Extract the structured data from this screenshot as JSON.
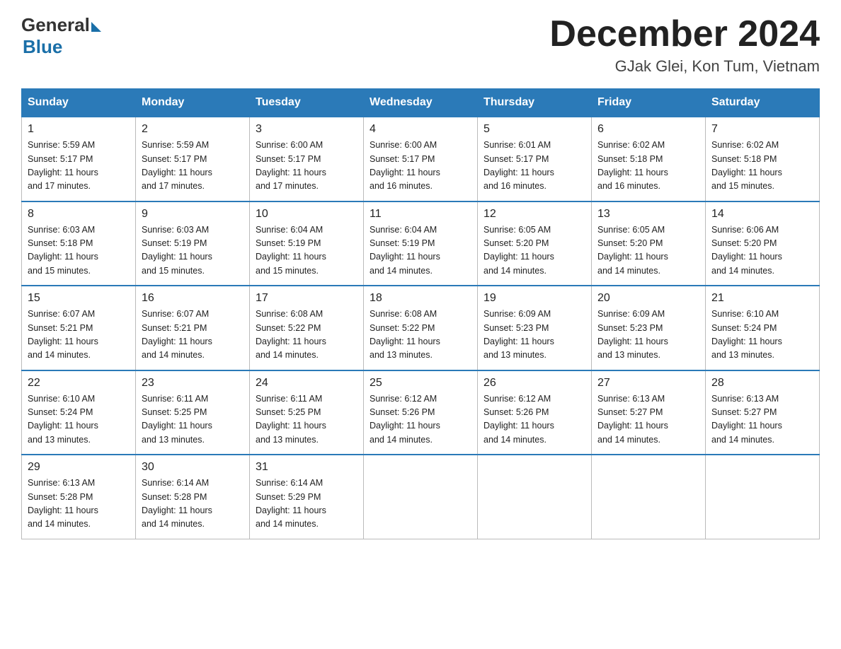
{
  "header": {
    "logo_general": "General",
    "logo_blue": "Blue",
    "month_title": "December 2024",
    "location": "GJak Glei, Kon Tum, Vietnam"
  },
  "weekdays": [
    "Sunday",
    "Monday",
    "Tuesday",
    "Wednesday",
    "Thursday",
    "Friday",
    "Saturday"
  ],
  "weeks": [
    [
      {
        "day": "1",
        "sunrise": "5:59 AM",
        "sunset": "5:17 PM",
        "daylight": "11 hours and 17 minutes."
      },
      {
        "day": "2",
        "sunrise": "5:59 AM",
        "sunset": "5:17 PM",
        "daylight": "11 hours and 17 minutes."
      },
      {
        "day": "3",
        "sunrise": "6:00 AM",
        "sunset": "5:17 PM",
        "daylight": "11 hours and 17 minutes."
      },
      {
        "day": "4",
        "sunrise": "6:00 AM",
        "sunset": "5:17 PM",
        "daylight": "11 hours and 16 minutes."
      },
      {
        "day": "5",
        "sunrise": "6:01 AM",
        "sunset": "5:17 PM",
        "daylight": "11 hours and 16 minutes."
      },
      {
        "day": "6",
        "sunrise": "6:02 AM",
        "sunset": "5:18 PM",
        "daylight": "11 hours and 16 minutes."
      },
      {
        "day": "7",
        "sunrise": "6:02 AM",
        "sunset": "5:18 PM",
        "daylight": "11 hours and 15 minutes."
      }
    ],
    [
      {
        "day": "8",
        "sunrise": "6:03 AM",
        "sunset": "5:18 PM",
        "daylight": "11 hours and 15 minutes."
      },
      {
        "day": "9",
        "sunrise": "6:03 AM",
        "sunset": "5:19 PM",
        "daylight": "11 hours and 15 minutes."
      },
      {
        "day": "10",
        "sunrise": "6:04 AM",
        "sunset": "5:19 PM",
        "daylight": "11 hours and 15 minutes."
      },
      {
        "day": "11",
        "sunrise": "6:04 AM",
        "sunset": "5:19 PM",
        "daylight": "11 hours and 14 minutes."
      },
      {
        "day": "12",
        "sunrise": "6:05 AM",
        "sunset": "5:20 PM",
        "daylight": "11 hours and 14 minutes."
      },
      {
        "day": "13",
        "sunrise": "6:05 AM",
        "sunset": "5:20 PM",
        "daylight": "11 hours and 14 minutes."
      },
      {
        "day": "14",
        "sunrise": "6:06 AM",
        "sunset": "5:20 PM",
        "daylight": "11 hours and 14 minutes."
      }
    ],
    [
      {
        "day": "15",
        "sunrise": "6:07 AM",
        "sunset": "5:21 PM",
        "daylight": "11 hours and 14 minutes."
      },
      {
        "day": "16",
        "sunrise": "6:07 AM",
        "sunset": "5:21 PM",
        "daylight": "11 hours and 14 minutes."
      },
      {
        "day": "17",
        "sunrise": "6:08 AM",
        "sunset": "5:22 PM",
        "daylight": "11 hours and 14 minutes."
      },
      {
        "day": "18",
        "sunrise": "6:08 AM",
        "sunset": "5:22 PM",
        "daylight": "11 hours and 13 minutes."
      },
      {
        "day": "19",
        "sunrise": "6:09 AM",
        "sunset": "5:23 PM",
        "daylight": "11 hours and 13 minutes."
      },
      {
        "day": "20",
        "sunrise": "6:09 AM",
        "sunset": "5:23 PM",
        "daylight": "11 hours and 13 minutes."
      },
      {
        "day": "21",
        "sunrise": "6:10 AM",
        "sunset": "5:24 PM",
        "daylight": "11 hours and 13 minutes."
      }
    ],
    [
      {
        "day": "22",
        "sunrise": "6:10 AM",
        "sunset": "5:24 PM",
        "daylight": "11 hours and 13 minutes."
      },
      {
        "day": "23",
        "sunrise": "6:11 AM",
        "sunset": "5:25 PM",
        "daylight": "11 hours and 13 minutes."
      },
      {
        "day": "24",
        "sunrise": "6:11 AM",
        "sunset": "5:25 PM",
        "daylight": "11 hours and 13 minutes."
      },
      {
        "day": "25",
        "sunrise": "6:12 AM",
        "sunset": "5:26 PM",
        "daylight": "11 hours and 14 minutes."
      },
      {
        "day": "26",
        "sunrise": "6:12 AM",
        "sunset": "5:26 PM",
        "daylight": "11 hours and 14 minutes."
      },
      {
        "day": "27",
        "sunrise": "6:13 AM",
        "sunset": "5:27 PM",
        "daylight": "11 hours and 14 minutes."
      },
      {
        "day": "28",
        "sunrise": "6:13 AM",
        "sunset": "5:27 PM",
        "daylight": "11 hours and 14 minutes."
      }
    ],
    [
      {
        "day": "29",
        "sunrise": "6:13 AM",
        "sunset": "5:28 PM",
        "daylight": "11 hours and 14 minutes."
      },
      {
        "day": "30",
        "sunrise": "6:14 AM",
        "sunset": "5:28 PM",
        "daylight": "11 hours and 14 minutes."
      },
      {
        "day": "31",
        "sunrise": "6:14 AM",
        "sunset": "5:29 PM",
        "daylight": "11 hours and 14 minutes."
      },
      null,
      null,
      null,
      null
    ]
  ],
  "labels": {
    "sunrise": "Sunrise:",
    "sunset": "Sunset:",
    "daylight": "Daylight:"
  }
}
